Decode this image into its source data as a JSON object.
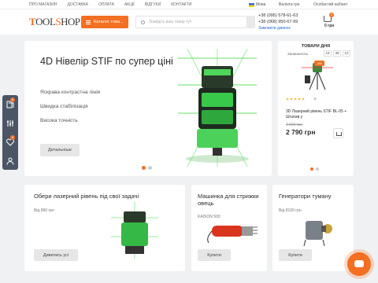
{
  "topnav": [
    "ПРО МАГАЗИН",
    "ДОСТАВКА",
    "ОПЛАТА",
    "АКЦІЇ",
    "ВІДГУКИ",
    "КОНТАКТИ"
  ],
  "lang": "Мова",
  "currency": "Валюта грн",
  "account": "Особистий кабінет",
  "logo": {
    "t": "T",
    "oo": "OOL",
    "s": "S",
    "hop": "HOP"
  },
  "catalog_label": "Каталог това...",
  "search_placeholder": "Знайдіть ваш товар тут",
  "phones": [
    "+38 (095) 578-61-63",
    "+38 (068) 950-67-99"
  ],
  "callback": "Замовити дзвінок",
  "cart": {
    "count": "0",
    "total": "0 грн"
  },
  "hero": {
    "title": "4D Нівелір STIF по супер ціні",
    "features": [
      "Яскрава контрастна лінія",
      "Швидка стабілізація",
      "Висока точність"
    ],
    "button": "Детальніше"
  },
  "deal": {
    "title": "ТОВАРИ ДНЯ",
    "timer_label": "Залишилось",
    "timer": [
      "19",
      "39",
      "10"
    ],
    "discount": "-4%",
    "rating_count": "8",
    "rating": 5,
    "name": "3D Лазерний рівень STIF BL-05 + Штатив у",
    "old_price": "2 900 грн",
    "new_price": "2 790 грн"
  },
  "sidebar_badges": [
    "0",
    "0"
  ],
  "cards": [
    {
      "title": "Обери лазерний рівень під свої задачі",
      "price": "Від 890 грн",
      "button": "Дивитись усі"
    },
    {
      "title": "Машинка для стрижки овець",
      "price": "KAISON 500",
      "button": "Купити"
    },
    {
      "title": "Генератори туману",
      "price": "Від 8100 грн",
      "button": "Купити"
    }
  ],
  "colors": {
    "accent": "#f36f21",
    "sidebar": "#4b5566"
  }
}
